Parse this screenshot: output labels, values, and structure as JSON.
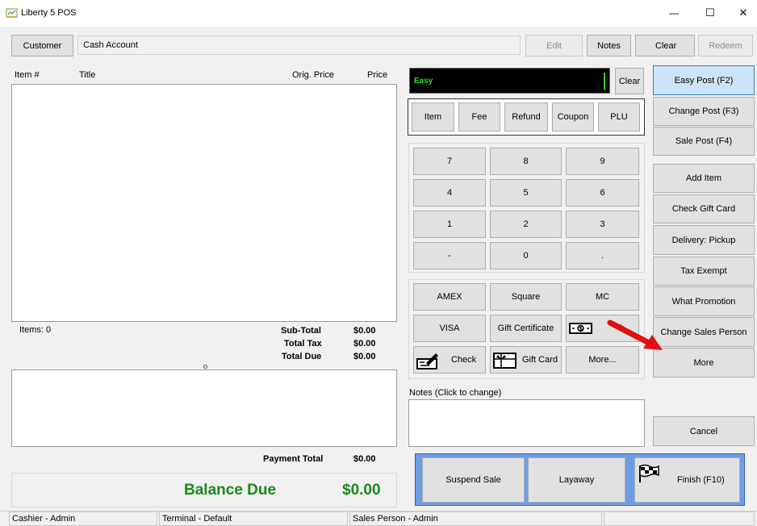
{
  "window": {
    "title": "Liberty 5 POS",
    "minimize_glyph": "—",
    "maximize_glyph": "☐",
    "close_glyph": "✕"
  },
  "topbar": {
    "customer_label": "Customer",
    "account_value": "Cash Account",
    "edit_label": "Edit",
    "notes_label": "Notes",
    "clear_label": "Clear",
    "redeem_label": "Redeem"
  },
  "items_table": {
    "columns": [
      "Item #",
      "Title",
      "Orig. Price",
      "Price"
    ]
  },
  "totals": {
    "items_count": "Items: 0",
    "subtotal_label": "Sub-Total",
    "subtotal_value": "$0.00",
    "tax_label": "Total Tax",
    "tax_value": "$0.00",
    "due_label": "Total Due",
    "due_value": "$0.00",
    "payment_total_label": "Payment Total",
    "payment_total_value": "$0.00",
    "balance_label": "Balance Due",
    "balance_value": "$0.00"
  },
  "entry": {
    "display_text": "Easy",
    "clear_label": "Clear"
  },
  "modes": [
    "Item",
    "Fee",
    "Refund",
    "Coupon",
    "PLU"
  ],
  "keypad": [
    "7",
    "8",
    "9",
    "4",
    "5",
    "6",
    "1",
    "2",
    "3",
    "-",
    "0",
    "."
  ],
  "tenders": {
    "amex": "AMEX",
    "square": "Square",
    "mc": "MC",
    "visa": "VISA",
    "gift_certificate": "Gift Certificate",
    "cash": "h",
    "check": "Check",
    "gift_card": "Gift Card",
    "more": "More..."
  },
  "notes": {
    "label": "Notes (Click to change)"
  },
  "actions": {
    "suspend": "Suspend Sale",
    "layaway": "Layaway",
    "finish": "Finish (F10)"
  },
  "side_buttons": {
    "easy_post": "Easy Post (F2)",
    "change_post": "Change Post (F3)",
    "sale_post": "Sale Post (F4)",
    "add_item": "Add Item",
    "check_gift_card": "Check Gift Card",
    "delivery": "Delivery: Pickup",
    "tax_exempt": "Tax Exempt",
    "what_promotion": "What Promotion",
    "change_sales_person": "Change Sales Person",
    "more": "More",
    "cancel": "Cancel"
  },
  "status_bar": {
    "cashier": "Cashier - Admin",
    "terminal": "Terminal - Default",
    "sales_person": "Sales Person - Admin"
  },
  "colors": {
    "balance_green": "#1a8a1a",
    "display_green": "#22dd22",
    "action_bar_blue": "#6f9ee6",
    "annotation_red": "#e01010",
    "easy_post_blue": "#cce4f7"
  },
  "icons": {
    "app": "app-icon",
    "cash": "cash-icon",
    "check": "check-writing-icon",
    "gift_card": "gift-card-icon",
    "finish": "checkered-flag-icon",
    "arrow": "red-arrow-annotation"
  }
}
